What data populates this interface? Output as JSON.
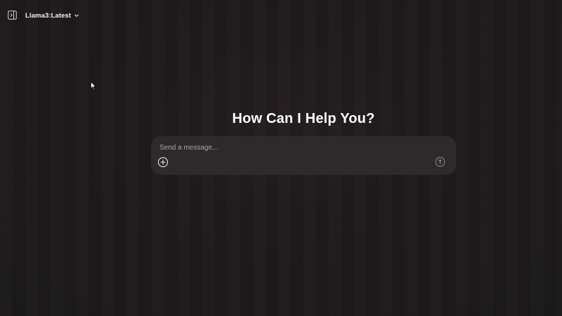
{
  "header": {
    "sidebar_toggle_icon": "sidebar-toggle-icon",
    "model_selector": {
      "label": "Llama3:Latest",
      "chevron_icon": "chevron-down-icon"
    }
  },
  "main": {
    "greeting": "How Can I Help You?",
    "composer": {
      "placeholder": "Send a message...",
      "value": "",
      "attach_icon": "plus-circle-icon",
      "send_icon": "arrow-up-circle-icon"
    }
  },
  "colors": {
    "background": "#1c1a1b",
    "composer_background": "#2c2a2b",
    "text_primary": "#ffffff",
    "placeholder": "#a9a6a7"
  }
}
